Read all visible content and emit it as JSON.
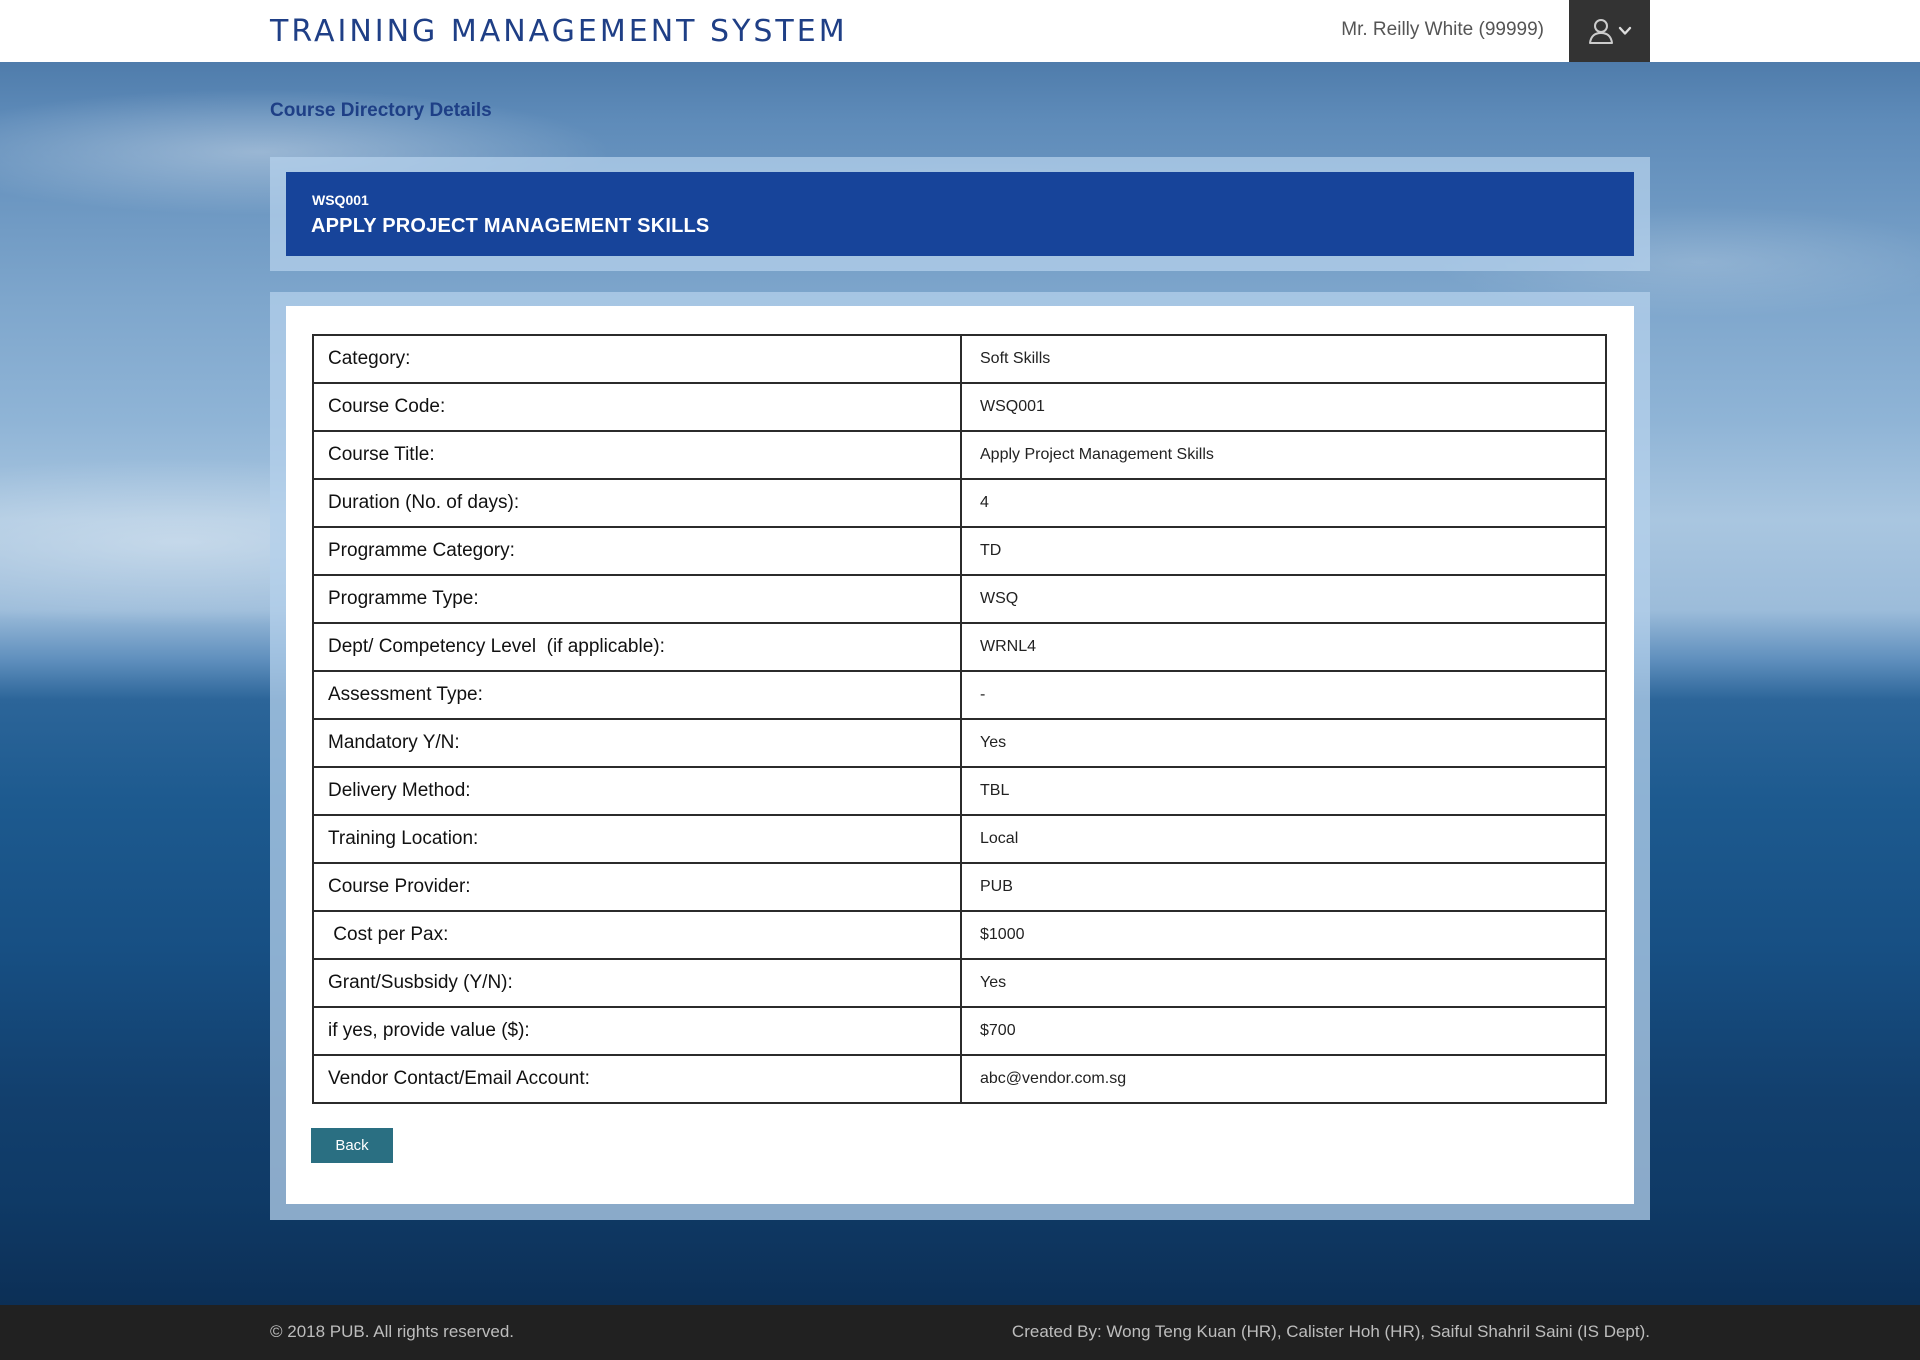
{
  "header": {
    "app_title": "TRAINING MANAGEMENT SYSTEM",
    "user_name": "Mr. Reilly White (99999)",
    "user_menu_icons": [
      "user-icon",
      "chevron-down-icon"
    ]
  },
  "page": {
    "heading": "Course Directory Details"
  },
  "course": {
    "code": "WSQ001",
    "title": "APPLY PROJECT MANAGEMENT SKILLS"
  },
  "details": [
    {
      "label": "Category:",
      "value": "Soft Skills"
    },
    {
      "label": "Course Code:",
      "value": "WSQ001"
    },
    {
      "label": "Course Title:",
      "value": "Apply Project Management Skills"
    },
    {
      "label": "Duration (No. of days):",
      "value": "4"
    },
    {
      "label": "Programme Category:",
      "value": "TD"
    },
    {
      "label": "Programme Type:",
      "value": "WSQ"
    },
    {
      "label": "Dept/ Competency Level  (if applicable):",
      "value": "WRNL4"
    },
    {
      "label": "Assessment Type:",
      "value": "-"
    },
    {
      "label": "Mandatory Y/N:",
      "value": "Yes"
    },
    {
      "label": "Delivery Method:",
      "value": "TBL"
    },
    {
      "label": "Training Location:",
      "value": "Local"
    },
    {
      "label": "Course Provider:",
      "value": "PUB"
    },
    {
      "label": " Cost per Pax:",
      "value": "$1000"
    },
    {
      "label": "Grant/Susbsidy (Y/N):",
      "value": "Yes"
    },
    {
      "label": "if yes, provide value ($):",
      "value": "$700"
    },
    {
      "label": "Vendor Contact/Email Account:",
      "value": "abc@vendor.com.sg"
    }
  ],
  "actions": {
    "back_label": "Back"
  },
  "footer": {
    "copyright": "© 2018 PUB. All rights reserved.",
    "credits": "Created By: Wong Teng Kuan (HR), Calister Hoh (HR), Saiful Shahril Saini (IS Dept)."
  },
  "colors": {
    "header_title": "#1f3f86",
    "title_card": "#17449a",
    "back_button": "#2a6f82",
    "footer_bg": "#212121",
    "user_menu_bg": "#333333"
  }
}
